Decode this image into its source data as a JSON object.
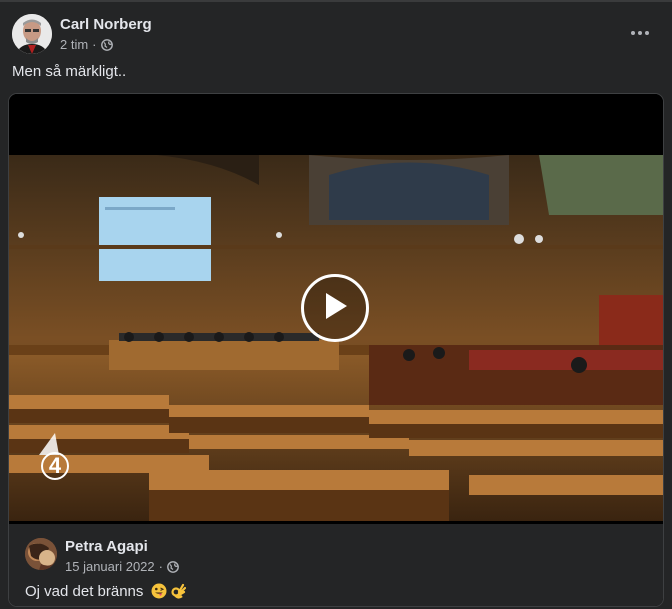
{
  "post": {
    "author": "Carl Norberg",
    "time": "2 tim",
    "separator": "·",
    "privacy_icon": "globe-icon",
    "text": "Men så märkligt..",
    "more_icon": "more-options-icon"
  },
  "shared_post": {
    "video_watermark": "4",
    "play_icon": "play-icon",
    "author": "Petra Agapi",
    "date": "15 januari 2022",
    "separator": "·",
    "privacy_icon": "globe-icon",
    "text": "Oj vad det bränns",
    "emojis": [
      "face-with-tongue-emoji",
      "ok-hand-emoji"
    ]
  },
  "colors": {
    "background": "#242526",
    "text_primary": "#e4e6eb",
    "text_secondary": "#b0b3b8",
    "border": "#3e4042"
  }
}
